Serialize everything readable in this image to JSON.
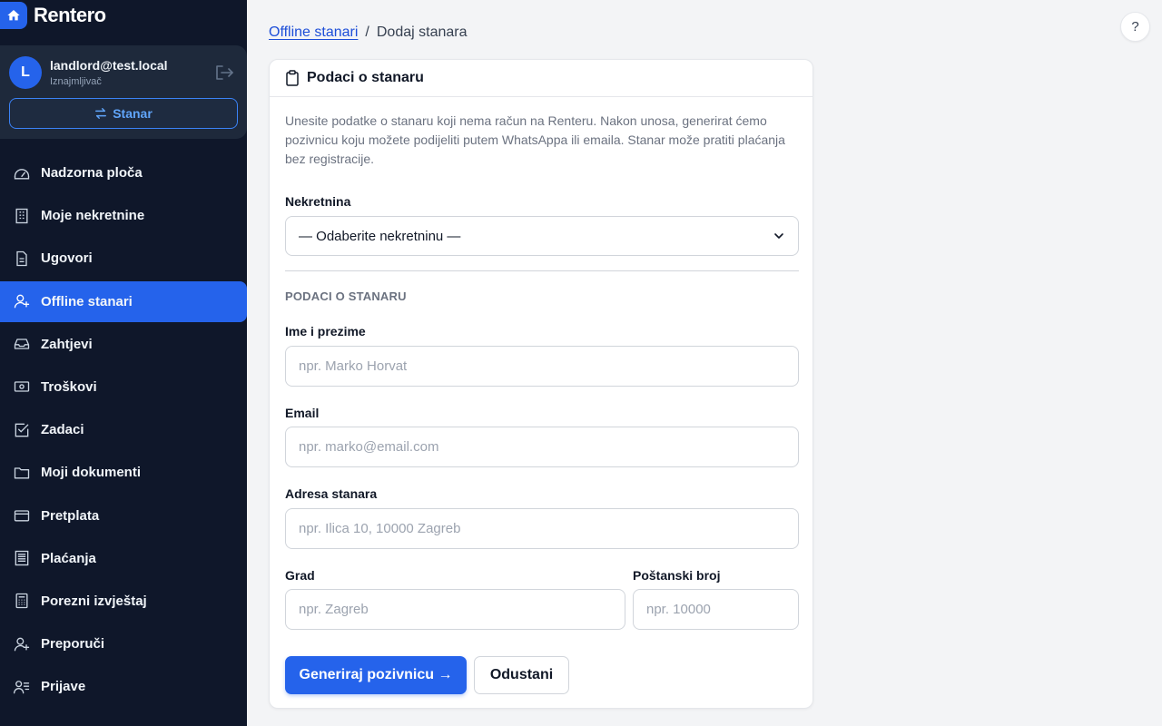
{
  "app": {
    "name": "Rentero",
    "accent": "#2563eb",
    "sidebar_bg": "#0f172a"
  },
  "user": {
    "initial": "L",
    "email": "landlord@test.local",
    "role": "Iznajmljivač",
    "switch_label": "Stanar"
  },
  "nav": [
    {
      "label": "Nadzorna ploča",
      "icon": "gauge-icon"
    },
    {
      "label": "Moje nekretnine",
      "icon": "building-icon"
    },
    {
      "label": "Ugovori",
      "icon": "document-icon"
    },
    {
      "label": "Offline stanari",
      "icon": "user-plus-icon",
      "active": true
    },
    {
      "label": "Zahtjevi",
      "icon": "inbox-icon"
    },
    {
      "label": "Troškovi",
      "icon": "cash-icon"
    },
    {
      "label": "Zadaci",
      "icon": "checkbox-icon"
    },
    {
      "label": "Moji dokumenti",
      "icon": "folder-icon"
    },
    {
      "label": "Pretplata",
      "icon": "credit-card-icon"
    },
    {
      "label": "Plaćanja",
      "icon": "receipt-icon"
    },
    {
      "label": "Porezni izvještaj",
      "icon": "calculator-icon"
    },
    {
      "label": "Preporuči",
      "icon": "user-plus-icon"
    },
    {
      "label": "Prijave",
      "icon": "users-list-icon"
    }
  ],
  "breadcrumb": {
    "parent": "Offline stanari",
    "separator": "/",
    "current": "Dodaj stanara"
  },
  "help_label": "?",
  "card": {
    "title": "Podaci o stanaru",
    "intro": "Unesite podatke o stanaru koji nema račun na Renteru. Nakon unosa, generirat ćemo pozivnicu koju možete podijeliti putem WhatsAppa ili emaila. Stanar može pratiti plaćanja bez registracije.",
    "property_label": "Nekretnina",
    "property_value": "— Odaberite nekretninu —",
    "section_heading": "PODACI O STANARU",
    "name_label": "Ime i prezime",
    "name_placeholder": "npr. Marko Horvat",
    "email_label": "Email",
    "email_placeholder": "npr. marko@email.com",
    "address_label": "Adresa stanara",
    "address_placeholder": "npr. Ilica 10, 10000 Zagreb",
    "city_label": "Grad",
    "city_placeholder": "npr. Zagreb",
    "zip_label": "Poštanski broj",
    "zip_placeholder": "npr. 10000",
    "submit_label": "Generiraj pozivnicu →",
    "cancel_label": "Odustani"
  }
}
